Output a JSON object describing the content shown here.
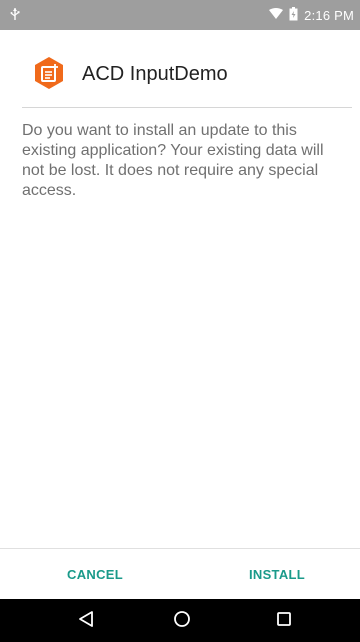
{
  "status_bar": {
    "time": "2:16 PM",
    "usb_icon": "usb-icon",
    "wifi_icon": "wifi-icon",
    "battery_icon": "battery-icon",
    "background": "#9e9e9e"
  },
  "header": {
    "app_name": "ACD InputDemo",
    "app_icon": "app-icon",
    "icon_color": "#f06a1b"
  },
  "message": {
    "text": "Do you want to install an update to this existing application? Your existing data will not be lost. It does not require any special access."
  },
  "actions": {
    "cancel_label": "CANCEL",
    "install_label": "INSTALL",
    "accent_color": "#1a9a8a"
  },
  "nav_bar": {
    "back_icon": "back-icon",
    "home_icon": "home-icon",
    "recents_icon": "recents-icon"
  }
}
